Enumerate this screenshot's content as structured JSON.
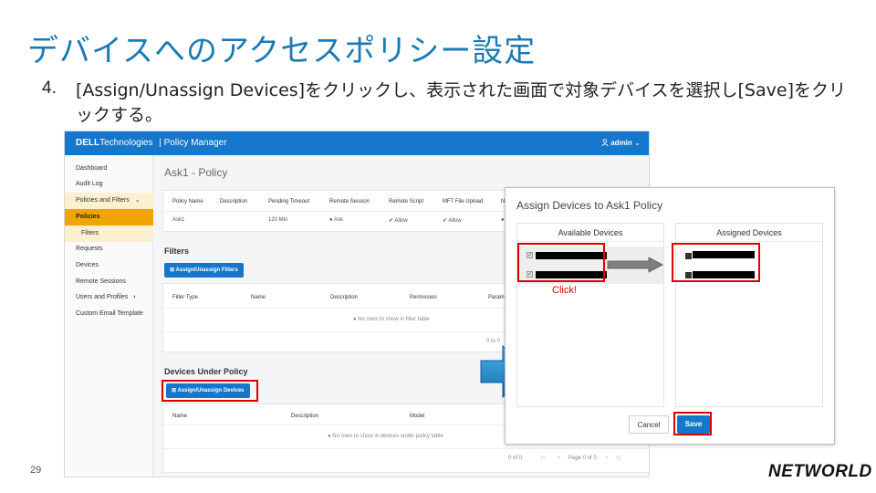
{
  "slide": {
    "title": "デバイスへのアクセスポリシー設定",
    "step_number": "4.",
    "step_text": "[Assign/Unassign Devices]をクリックし、表示された画面で対象デバイスを選択し[Save]をクリックする。",
    "page_number": "29",
    "logo": "NETWORLD"
  },
  "app": {
    "brand_bold": "DELL",
    "brand_rest": "Technologies",
    "product": "| Policy Manager",
    "user": "admin",
    "sidebar": {
      "items": [
        "Dashboard",
        "Audit Log",
        "Policies and Filters",
        "Policies",
        "Filters",
        "Requests",
        "Devices",
        "Remote Sessions",
        "Users and Profiles",
        "Custom Email Template"
      ],
      "expand_glyph": "⌄",
      "submenu_glyph": "›"
    },
    "page_title": "Ask1 - Policy",
    "policy_table": {
      "headers": [
        "Policy Name",
        "Description",
        "Pending Timeout",
        "Remote Session",
        "Remote Script",
        "MFT File Upload",
        "N"
      ],
      "row": [
        "Ask1",
        "",
        "120 Min",
        "Ask",
        "Allow",
        "Allow",
        "●"
      ]
    },
    "filters": {
      "title": "Filters",
      "button": "Assign/Unassign Filters",
      "headers": [
        "Filter Type",
        "Name",
        "Description",
        "Permission",
        "Param"
      ],
      "empty": "No rows to show in filter table",
      "paging": "0 to 0"
    },
    "devices": {
      "title": "Devices Under Policy",
      "button": "Assign/Unassign Devices",
      "headers": [
        "Name",
        "Description",
        "Model"
      ],
      "empty": "No rows to show in devices under policy table",
      "paging_count": "0 of 0",
      "paging_page": "Page 0 of 0",
      "nav_first": "|<",
      "nav_prev": "<",
      "nav_next": ">",
      "nav_last": ">|"
    }
  },
  "dialog": {
    "title": "Assign Devices to Ask1 Policy",
    "available_title": "Available Devices",
    "assigned_title": "Assigned Devices",
    "cancel": "Cancel",
    "save": "Save",
    "click_note": "Click!"
  },
  "colors": {
    "title_blue": "#1a7ab5",
    "app_blue": "#1577cb",
    "highlight_red": "#e00000",
    "active_orange": "#f0a500"
  }
}
